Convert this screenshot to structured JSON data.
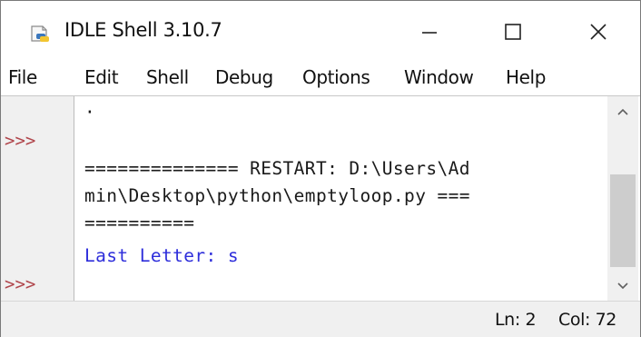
{
  "window": {
    "title": "IDLE Shell 3.10.7",
    "minimize_glyph": "—",
    "maximize_glyph": "☐",
    "close_glyph": "✕",
    "app_icon": "python-idle-icon"
  },
  "menubar": {
    "items": [
      "File",
      "Edit",
      "Shell",
      "Debug",
      "Options",
      "Window",
      "Help"
    ]
  },
  "shell": {
    "prompts": [
      ">>>",
      ">>>"
    ],
    "lines": [
      "·",
      "",
      "============== RESTART: D:\\Users\\Ad",
      "min\\Desktop\\python\\emptyloop.py ===",
      "==========",
      "Last Letter: s"
    ]
  },
  "statusbar": {
    "line": "Ln: 2",
    "col": "Col: 72"
  },
  "colors": {
    "prompt": "#b0454b",
    "output": "#2e2edb",
    "text": "#1a1a1a",
    "gutter": "#f0f0f0"
  }
}
